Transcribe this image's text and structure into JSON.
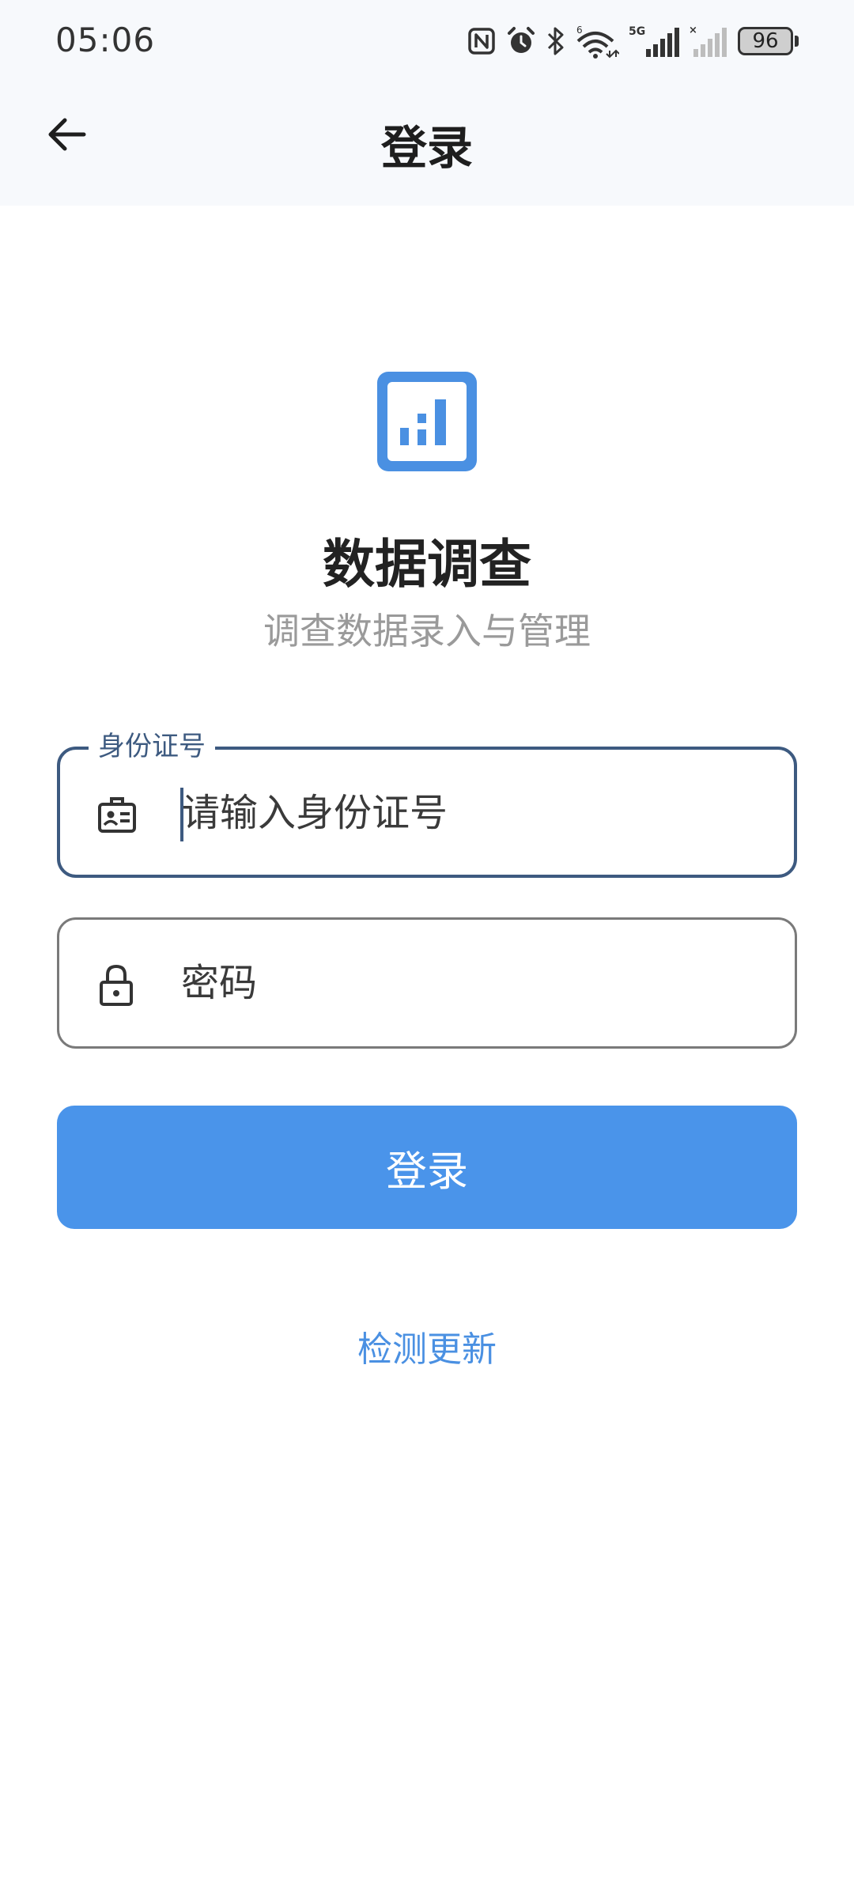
{
  "status_bar": {
    "time": "05:06",
    "battery_level": "96",
    "icons": [
      "nfc-icon",
      "alarm-icon",
      "bluetooth-icon",
      "wifi-6-icon",
      "signal-5g-icon",
      "signal-no-sim-icon",
      "battery-icon"
    ]
  },
  "header": {
    "title": "登录",
    "back_icon": "arrow-left-icon"
  },
  "app": {
    "logo_icon": "bar-chart-icon",
    "title": "数据调查",
    "subtitle": "调查数据录入与管理"
  },
  "form": {
    "id_field": {
      "label": "身份证号",
      "placeholder": "请输入身份证号",
      "value": "",
      "icon": "id-badge-icon"
    },
    "password_field": {
      "placeholder": "密码",
      "value": "",
      "icon": "lock-icon"
    },
    "login_button": "登录",
    "update_link": "检测更新"
  },
  "colors": {
    "accent": "#4a90e2",
    "focus_border": "#3d5a80",
    "header_bg": "#f7f9fc"
  }
}
